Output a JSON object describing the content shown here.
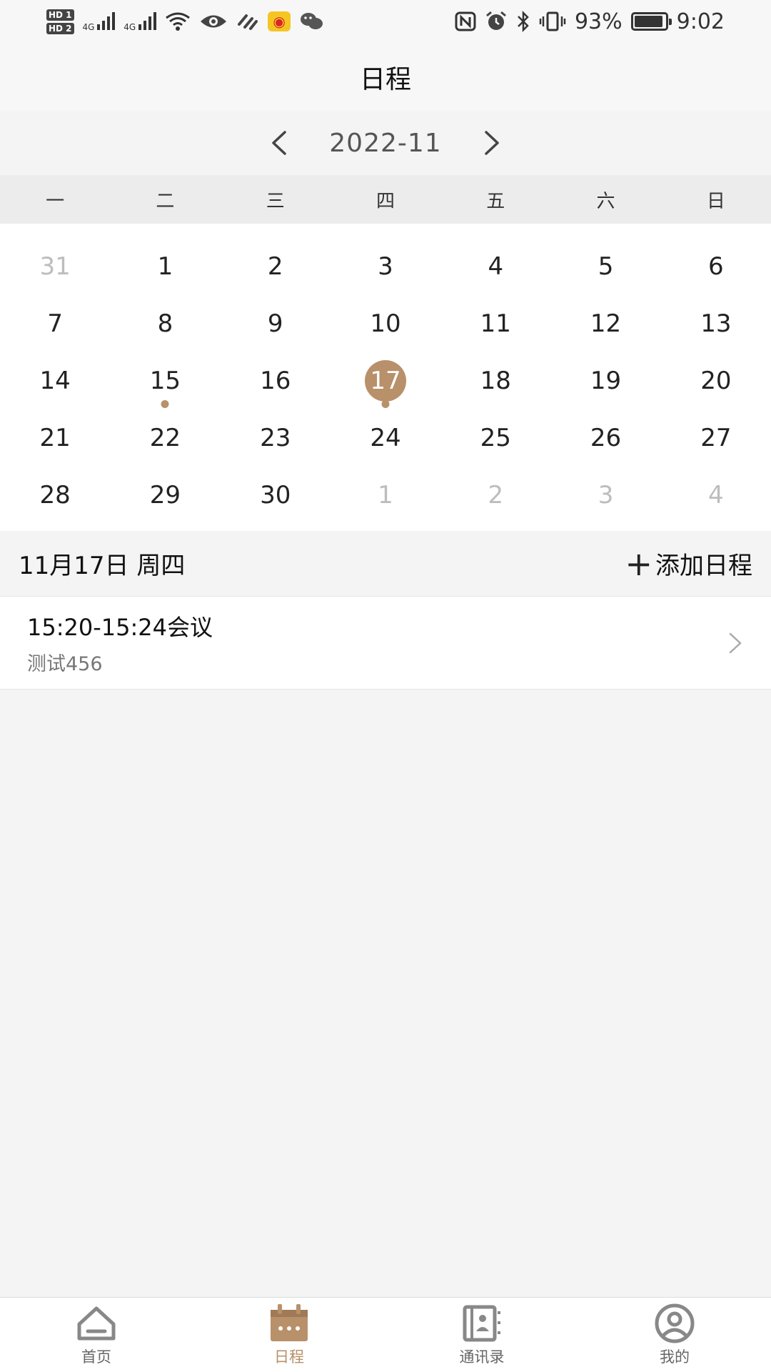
{
  "status_bar": {
    "hd1": "HD 1",
    "hd2": "HD 2",
    "net1": "4G",
    "net2": "4G",
    "battery_percent": "93%",
    "battery_level": 0.93,
    "time": "9:02",
    "weibo_glyph": "◉",
    "icons": [
      "wifi-icon",
      "eye-icon",
      "link-icon",
      "weibo-icon",
      "wechat-icon",
      "nfc-icon",
      "alarm-icon",
      "bluetooth-icon",
      "vibrate-icon",
      "battery-icon"
    ]
  },
  "header": {
    "title": "日程"
  },
  "month_nav": {
    "month": "2022-11"
  },
  "week_days": [
    "一",
    "二",
    "三",
    "四",
    "五",
    "六",
    "日"
  ],
  "calendar": {
    "rows": [
      [
        {
          "d": "31",
          "muted": true
        },
        {
          "d": "1"
        },
        {
          "d": "2"
        },
        {
          "d": "3"
        },
        {
          "d": "4"
        },
        {
          "d": "5"
        },
        {
          "d": "6"
        }
      ],
      [
        {
          "d": "7"
        },
        {
          "d": "8"
        },
        {
          "d": "9"
        },
        {
          "d": "10"
        },
        {
          "d": "11"
        },
        {
          "d": "12"
        },
        {
          "d": "13"
        }
      ],
      [
        {
          "d": "14"
        },
        {
          "d": "15",
          "dot": true
        },
        {
          "d": "16"
        },
        {
          "d": "17",
          "selected": true,
          "dot": true
        },
        {
          "d": "18"
        },
        {
          "d": "19"
        },
        {
          "d": "20"
        }
      ],
      [
        {
          "d": "21"
        },
        {
          "d": "22"
        },
        {
          "d": "23"
        },
        {
          "d": "24"
        },
        {
          "d": "25"
        },
        {
          "d": "26"
        },
        {
          "d": "27"
        }
      ],
      [
        {
          "d": "28"
        },
        {
          "d": "29"
        },
        {
          "d": "30"
        },
        {
          "d": "1",
          "muted": true
        },
        {
          "d": "2",
          "muted": true
        },
        {
          "d": "3",
          "muted": true
        },
        {
          "d": "4",
          "muted": true
        }
      ]
    ]
  },
  "date_bar": {
    "date": "11月17日 周四",
    "add_plus": "+",
    "add_label": "添加日程"
  },
  "events": [
    {
      "title": "15:20-15:24会议",
      "subtitle": "测试456"
    }
  ],
  "bottom_nav": {
    "items": [
      {
        "label": "首页",
        "icon": "home-icon"
      },
      {
        "label": "日程",
        "icon": "calendar-icon",
        "active": true
      },
      {
        "label": "通讯录",
        "icon": "contacts-icon"
      },
      {
        "label": "我的",
        "icon": "profile-icon"
      }
    ]
  },
  "colors": {
    "accent": "#b8906a",
    "nav_inactive": "#888888",
    "muted_text": "#bdbdbd"
  }
}
